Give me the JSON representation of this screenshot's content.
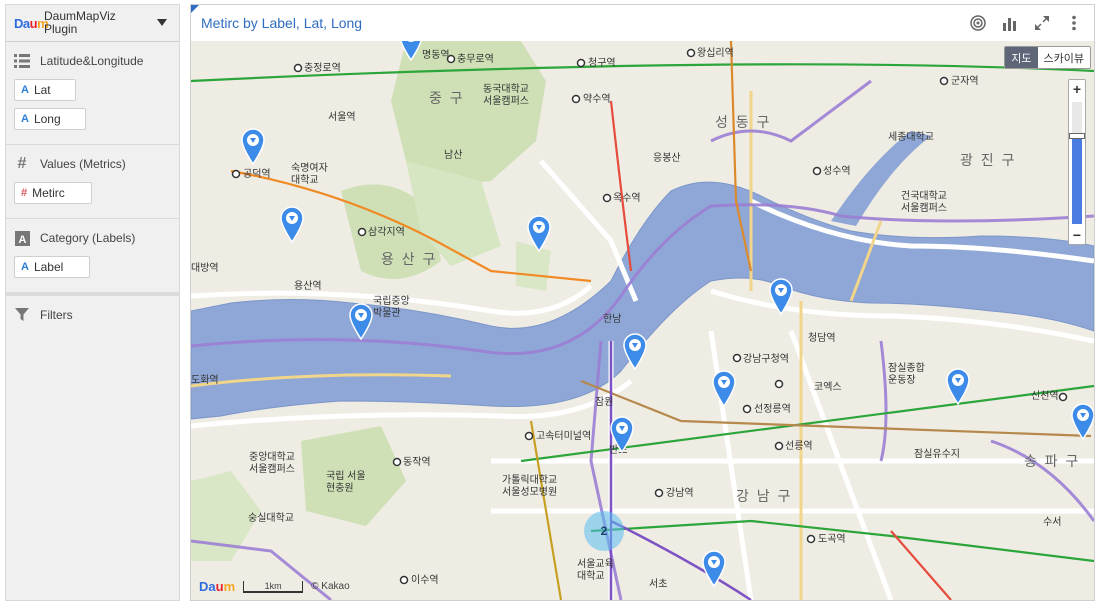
{
  "panel": {
    "logo": [
      "Da",
      "u",
      "m"
    ],
    "plugin_title": "DaumMapViz Plugin",
    "sections": [
      {
        "title": "Latitude&Longitude",
        "icon": "list-icon",
        "fields": [
          {
            "prefix": "A",
            "label": "Lat"
          },
          {
            "prefix": "A",
            "label": "Long"
          }
        ]
      },
      {
        "title": "Values (Metrics)",
        "icon": "hash-icon",
        "fields": [
          {
            "prefix": "#",
            "label": "Metirc"
          }
        ]
      },
      {
        "title": "Category (Labels)",
        "icon": "text-icon",
        "fields": [
          {
            "prefix": "A",
            "label": "Label"
          }
        ]
      }
    ],
    "filters_label": "Filters"
  },
  "widget": {
    "title": "Metirc by Label, Lat, Long",
    "toolbar_icons": [
      "target-icon",
      "bar-chart-icon",
      "expand-icon",
      "more-vertical-icon"
    ]
  },
  "map": {
    "maptype": {
      "map": "지도",
      "skyview": "스카이뷰",
      "selected": "지도"
    },
    "zoom": {
      "plus": "+",
      "minus": "−",
      "level_fraction": 0.72
    },
    "scale_label": "1km",
    "copyright": "© Kakao",
    "cluster_count": "2",
    "districts": [
      "중 구",
      "용 산 구",
      "성 동 구",
      "광 진 구",
      "강 남 구",
      "송 파 구"
    ],
    "labels": [
      "충정로역",
      "명동역",
      "충무로역",
      "청구역",
      "왕십리역",
      "군자역",
      "숙명여자\n대학교",
      "서울역",
      "동국대학교\n서울캠퍼스",
      "약수역",
      "남산",
      "응봉산",
      "성수역",
      "세종대학교",
      "건국대학교\n서울캠퍼스",
      "공덕역",
      "옥수역",
      "삼각지역",
      "용산역",
      "국립중앙\n박물관",
      "한남",
      "강남구청역",
      "청담역",
      "잠실종합\n운동장",
      "코엑스",
      "선정릉역",
      "고속터미널역",
      "선릉역",
      "동작역",
      "잠원",
      "반포",
      "중앙대학교\n서울캠퍼스",
      "국립 서울\n현충원",
      "가톨릭대학교\n서울성모병원",
      "강남역",
      "도곡역",
      "숭실대학교",
      "서울교육\n대학교",
      "이수역",
      "서초",
      "잠실유수지",
      "수서",
      "도화역",
      "대방역",
      "신천역"
    ]
  }
}
